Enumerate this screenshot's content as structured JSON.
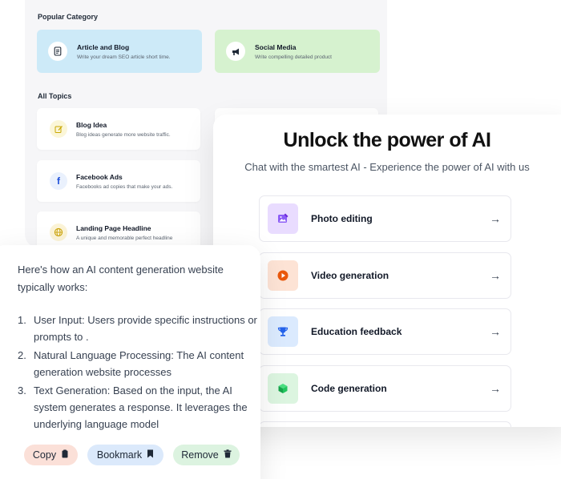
{
  "popular": {
    "title": "Popular Category",
    "cards": [
      {
        "title": "Article and Blog",
        "subtitle": "Write your dream SEO article short time.",
        "icon": "document-icon",
        "color": "#cdeaf8"
      },
      {
        "title": "Social Media",
        "subtitle": "Write compelling detailed product",
        "icon": "megaphone-icon",
        "color": "#d6f2cf"
      }
    ]
  },
  "topics": {
    "title": "All Topics",
    "items": [
      {
        "title": "Blog Idea",
        "subtitle": "Blog ideas generate more website traffic.",
        "icon": "edit-icon"
      },
      {
        "title": "Facebook Ads",
        "subtitle": "Facebooks ad copies that make your ads.",
        "icon": "facebook-icon"
      },
      {
        "title": "Landing Page Headline",
        "subtitle": "A unique and memorable perfect headline",
        "icon": "globe-icon"
      }
    ]
  },
  "ai": {
    "title": "Unlock the power of AI",
    "subtitle": "Chat with the smartest AI - Experience the power of AI with us",
    "features": [
      {
        "label": "Photo editing",
        "icon": "image-edit-icon",
        "color": "#e9dcff"
      },
      {
        "label": "Video generation",
        "icon": "play-icon",
        "color": "#fde3d5"
      },
      {
        "label": "Education feedback",
        "icon": "trophy-icon",
        "color": "#dbeafe"
      },
      {
        "label": "Code generation",
        "icon": "cube-icon",
        "color": "#dcf5e0"
      }
    ],
    "arrow": "→"
  },
  "chat": {
    "intro": "Here's how an AI content generation website typically works:",
    "steps": [
      {
        "num": "1.",
        "text": "User Input: Users provide specific instructions or prompts to ."
      },
      {
        "num": "2.",
        "text": "Natural Language Processing: The AI content generation website processes"
      },
      {
        "num": "3.",
        "text": "Text Generation: Based on the input, the AI system generates a response. It leverages the underlying language model"
      }
    ],
    "buttons": {
      "copy": "Copy",
      "bookmark": "Bookmark",
      "remove": "Remove"
    }
  }
}
